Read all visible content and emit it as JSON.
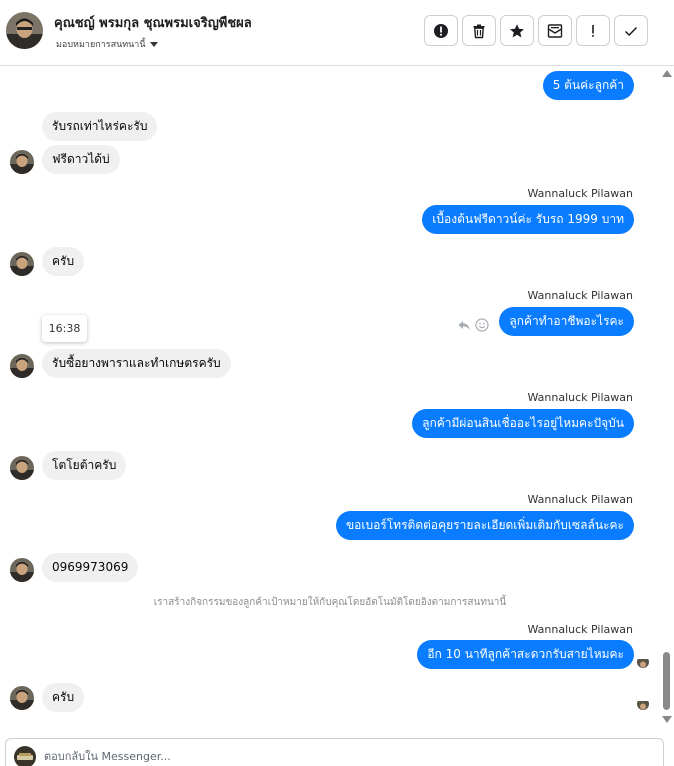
{
  "header": {
    "contact_name": "คุณชญ์ พรมกุล ชุณพรมเจริญพืชผล",
    "assign_label": "มอบหมายการสนทนานี้",
    "actions": [
      {
        "name": "report-button",
        "icon": "exclamation-circle-icon"
      },
      {
        "name": "delete-button",
        "icon": "trash-icon"
      },
      {
        "name": "star-button",
        "icon": "star-icon"
      },
      {
        "name": "mark-unread-button",
        "icon": "envelope-icon"
      },
      {
        "name": "important-button",
        "icon": "exclamation-icon"
      },
      {
        "name": "done-button",
        "icon": "check-icon"
      }
    ]
  },
  "messages": {
    "m1": "5 ต้นค่ะลูกค้า",
    "m2": "รับรถเท่าไหร่คะรับ",
    "m3": "ฟรีดาวได้บ่",
    "m4_sender": "Wannaluck Pilawan",
    "m4": "เบื้องต้นฟรีดาวน์ค่ะ  รับรถ 1999 บาท",
    "m5": "ครับ",
    "m6_sender": "Wannaluck Pilawan",
    "timestamp": "16:38",
    "m6": "ลูกค้าทำอาชีพอะไรคะ",
    "m7": "รับซื้อยางพาราและทำเกษตรครับ",
    "m8_sender": "Wannaluck Pilawan",
    "m8": "ลูกค้ามีผ่อนสินเชื่ออะไรอยู่ไหมคะปัจุบัน",
    "m9": "โตโยต้าครับ",
    "m10_sender": "Wannaluck Pilawan",
    "m10": "ขอเบอร์โทรติดต่อคุยรายละเอียดเพิ่มเติมกับเซลล์นะคะ",
    "m11": "0969973069",
    "system_note": "เราสร้างกิจกรรมของลูกค้าเป้าหมายให้กับคุณโดยอัตโนมัติโดยอิงตามการสนทนานี้",
    "m12_sender": "Wannaluck Pilawan",
    "m12": "อีก 10 นาทีลูกค้าสะดวกรับสายไหมคะ",
    "m13": "ครับ"
  },
  "composer": {
    "placeholder": "ตอบกลับใน Messenger..."
  },
  "colors": {
    "outgoing_bubble": "#0a7cff",
    "incoming_bubble": "#f0f0f0"
  }
}
